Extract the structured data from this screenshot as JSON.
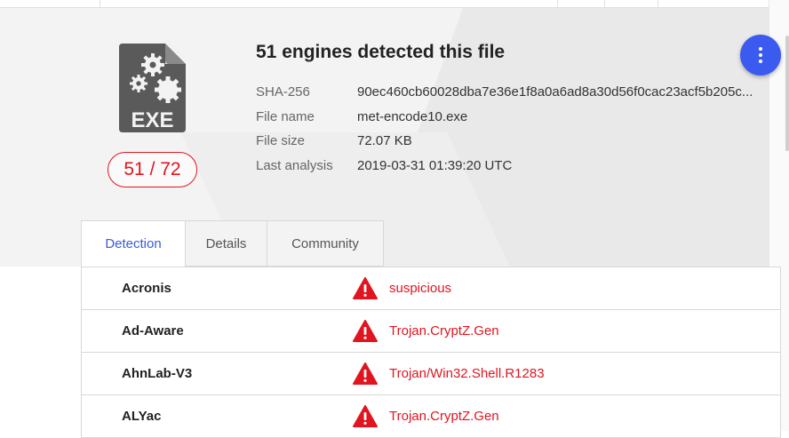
{
  "file": {
    "icon_label": "EXE",
    "score": "51 / 72",
    "headline": "51 engines detected this file",
    "meta": [
      {
        "label": "SHA-256",
        "value": "90ec460cb60028dba7e36e1f8a0a6ad8a30d56f0cac23acf5b205c..."
      },
      {
        "label": "File name",
        "value": "met-encode10.exe"
      },
      {
        "label": "File size",
        "value": "72.07 KB"
      },
      {
        "label": "Last analysis",
        "value": "2019-03-31 01:39:20 UTC"
      }
    ]
  },
  "tabs": [
    {
      "label": "Detection",
      "active": true
    },
    {
      "label": "Details",
      "active": false
    },
    {
      "label": "Community",
      "active": false
    }
  ],
  "detections": [
    {
      "engine": "Acronis",
      "result": "suspicious",
      "icon": "warning-icon"
    },
    {
      "engine": "Ad-Aware",
      "result": "Trojan.CryptZ.Gen",
      "icon": "warning-icon"
    },
    {
      "engine": "AhnLab-V3",
      "result": "Trojan/Win32.Shell.R1283",
      "icon": "warning-icon"
    },
    {
      "engine": "ALYac",
      "result": "Trojan.CryptZ.Gen",
      "icon": "warning-icon"
    }
  ],
  "colors": {
    "malicious": "#e0151f",
    "accent": "#3b5bf0",
    "icon_grey": "#5a5a5a"
  },
  "actions": {
    "menu_icon": "more-vertical-icon"
  }
}
